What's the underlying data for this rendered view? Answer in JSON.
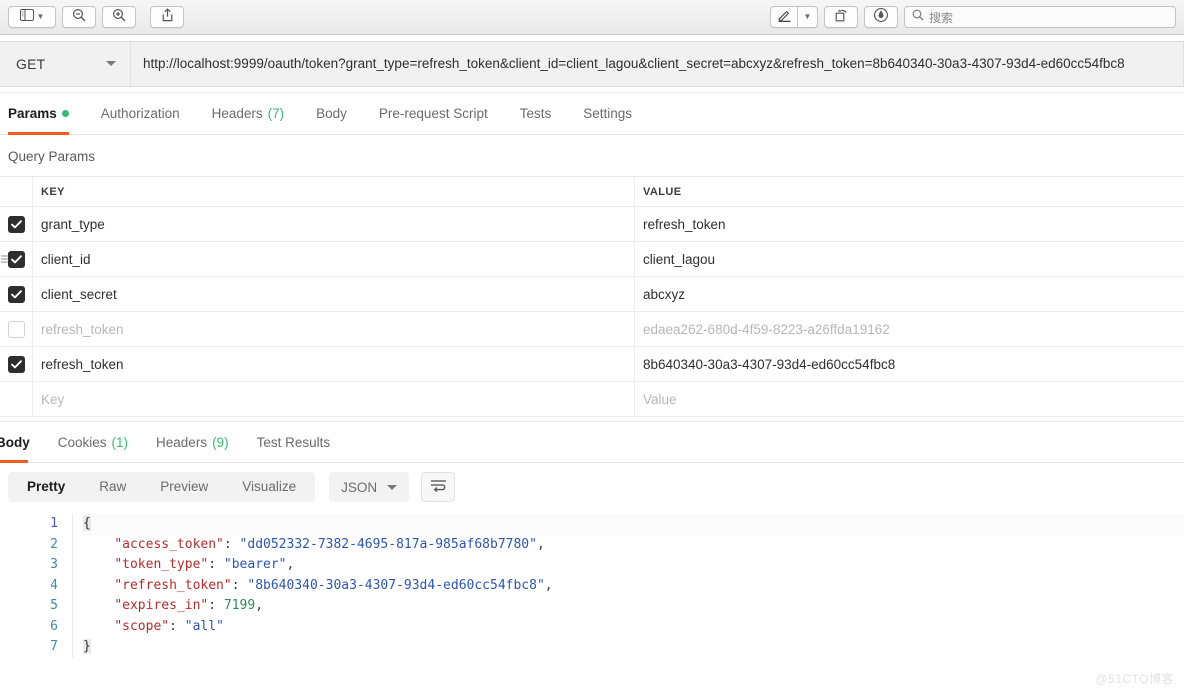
{
  "window_toolbar": {
    "buttons": [
      {
        "name": "sidebar-toggle",
        "icon": "sidebar-icon",
        "has_chevron": true
      },
      {
        "name": "zoom-out",
        "icon": "zoom-out-icon",
        "has_chevron": false
      },
      {
        "name": "zoom-in",
        "icon": "zoom-in-icon",
        "has_chevron": false
      },
      {
        "name": "share",
        "icon": "share-icon",
        "has_chevron": false
      }
    ],
    "right_buttons": [
      {
        "name": "markup",
        "icon": "pen-icon",
        "has_chevron": true
      },
      {
        "name": "rotate",
        "icon": "rotate-icon",
        "has_chevron": false
      },
      {
        "name": "annotate",
        "icon": "annotate-icon",
        "has_chevron": false
      }
    ],
    "search": {
      "icon": "search-icon",
      "placeholder": "搜索",
      "value": ""
    }
  },
  "request": {
    "method": "GET",
    "method_caret_icon": "chevron-down-icon",
    "url": "http://localhost:9999/oauth/token?grant_type=refresh_token&client_id=client_lagou&client_secret=abcxyz&refresh_token=8b640340-30a3-4307-93d4-ed60cc54fbc8",
    "tabs": [
      {
        "label": "Params",
        "badge": "",
        "dot": true,
        "active": true
      },
      {
        "label": "Authorization",
        "badge": "",
        "dot": false,
        "active": false
      },
      {
        "label": "Headers",
        "badge": "(7)",
        "dot": false,
        "active": false
      },
      {
        "label": "Body",
        "badge": "",
        "dot": false,
        "active": false
      },
      {
        "label": "Pre-request Script",
        "badge": "",
        "dot": false,
        "active": false
      },
      {
        "label": "Tests",
        "badge": "",
        "dot": false,
        "active": false
      },
      {
        "label": "Settings",
        "badge": "",
        "dot": false,
        "active": false
      }
    ]
  },
  "query_params": {
    "section_title": "Query Params",
    "columns": {
      "key": "KEY",
      "value": "VALUE"
    },
    "rows": [
      {
        "checked": true,
        "enabled": true,
        "key": "grant_type",
        "value": "refresh_token",
        "placeholder": false,
        "hovered": false
      },
      {
        "checked": true,
        "enabled": true,
        "key": "client_id",
        "value": "client_lagou",
        "placeholder": false,
        "hovered": true
      },
      {
        "checked": true,
        "enabled": true,
        "key": "client_secret",
        "value": "abcxyz",
        "placeholder": false,
        "hovered": false
      },
      {
        "checked": false,
        "enabled": false,
        "key": "refresh_token",
        "value": "edaea262-680d-4f59-8223-a26ffda19162",
        "placeholder": false,
        "hovered": false
      },
      {
        "checked": true,
        "enabled": true,
        "key": "refresh_token",
        "value": "8b640340-30a3-4307-93d4-ed60cc54fbc8",
        "placeholder": false,
        "hovered": false
      },
      {
        "checked": false,
        "enabled": true,
        "key": "Key",
        "value": "Value",
        "placeholder": true,
        "hovered": false
      }
    ]
  },
  "response": {
    "tabs": [
      {
        "label": "Body",
        "badge": "",
        "active": true
      },
      {
        "label": "Cookies",
        "badge": "(1)",
        "active": false
      },
      {
        "label": "Headers",
        "badge": "(9)",
        "active": false
      },
      {
        "label": "Test Results",
        "badge": "",
        "active": false
      }
    ],
    "format_modes": [
      {
        "label": "Pretty",
        "active": true
      },
      {
        "label": "Raw",
        "active": false
      },
      {
        "label": "Preview",
        "active": false
      },
      {
        "label": "Visualize",
        "active": false
      }
    ],
    "content_type": "JSON",
    "content_type_caret_icon": "chevron-down-icon",
    "wrap_button_icon": "word-wrap-icon",
    "line_numbers": [
      "1",
      "2",
      "3",
      "4",
      "5",
      "6",
      "7"
    ],
    "body_lines": [
      [
        {
          "t": "{",
          "c": "brace"
        }
      ],
      [
        {
          "t": "    ",
          "c": "p"
        },
        {
          "t": "\"access_token\"",
          "c": "k"
        },
        {
          "t": ": ",
          "c": "p"
        },
        {
          "t": "\"dd052332-7382-4695-817a-985af68b7780\"",
          "c": "s"
        },
        {
          "t": ",",
          "c": "p"
        }
      ],
      [
        {
          "t": "    ",
          "c": "p"
        },
        {
          "t": "\"token_type\"",
          "c": "k"
        },
        {
          "t": ": ",
          "c": "p"
        },
        {
          "t": "\"bearer\"",
          "c": "s"
        },
        {
          "t": ",",
          "c": "p"
        }
      ],
      [
        {
          "t": "    ",
          "c": "p"
        },
        {
          "t": "\"refresh_token\"",
          "c": "k"
        },
        {
          "t": ": ",
          "c": "p"
        },
        {
          "t": "\"8b640340-30a3-4307-93d4-ed60cc54fbc8\"",
          "c": "s"
        },
        {
          "t": ",",
          "c": "p"
        }
      ],
      [
        {
          "t": "    ",
          "c": "p"
        },
        {
          "t": "\"expires_in\"",
          "c": "k"
        },
        {
          "t": ": ",
          "c": "p"
        },
        {
          "t": "7199",
          "c": "n"
        },
        {
          "t": ",",
          "c": "p"
        }
      ],
      [
        {
          "t": "    ",
          "c": "p"
        },
        {
          "t": "\"scope\"",
          "c": "k"
        },
        {
          "t": ": ",
          "c": "p"
        },
        {
          "t": "\"all\"",
          "c": "s"
        }
      ],
      [
        {
          "t": "}",
          "c": "brace"
        }
      ]
    ],
    "json_values": {
      "access_token": "dd052332-7382-4695-817a-985af68b7780",
      "token_type": "bearer",
      "refresh_token": "8b640340-30a3-4307-93d4-ed60cc54fbc8",
      "expires_in": 7199,
      "scope": "all"
    }
  },
  "watermark": "@51CTO博客",
  "colors": {
    "accent": "#ef5b25",
    "green": "#3cb878",
    "json_key": "#b32d2d",
    "json_string": "#2d56b3",
    "json_number": "#2e8b57",
    "gutter": "#3f8d9b"
  }
}
